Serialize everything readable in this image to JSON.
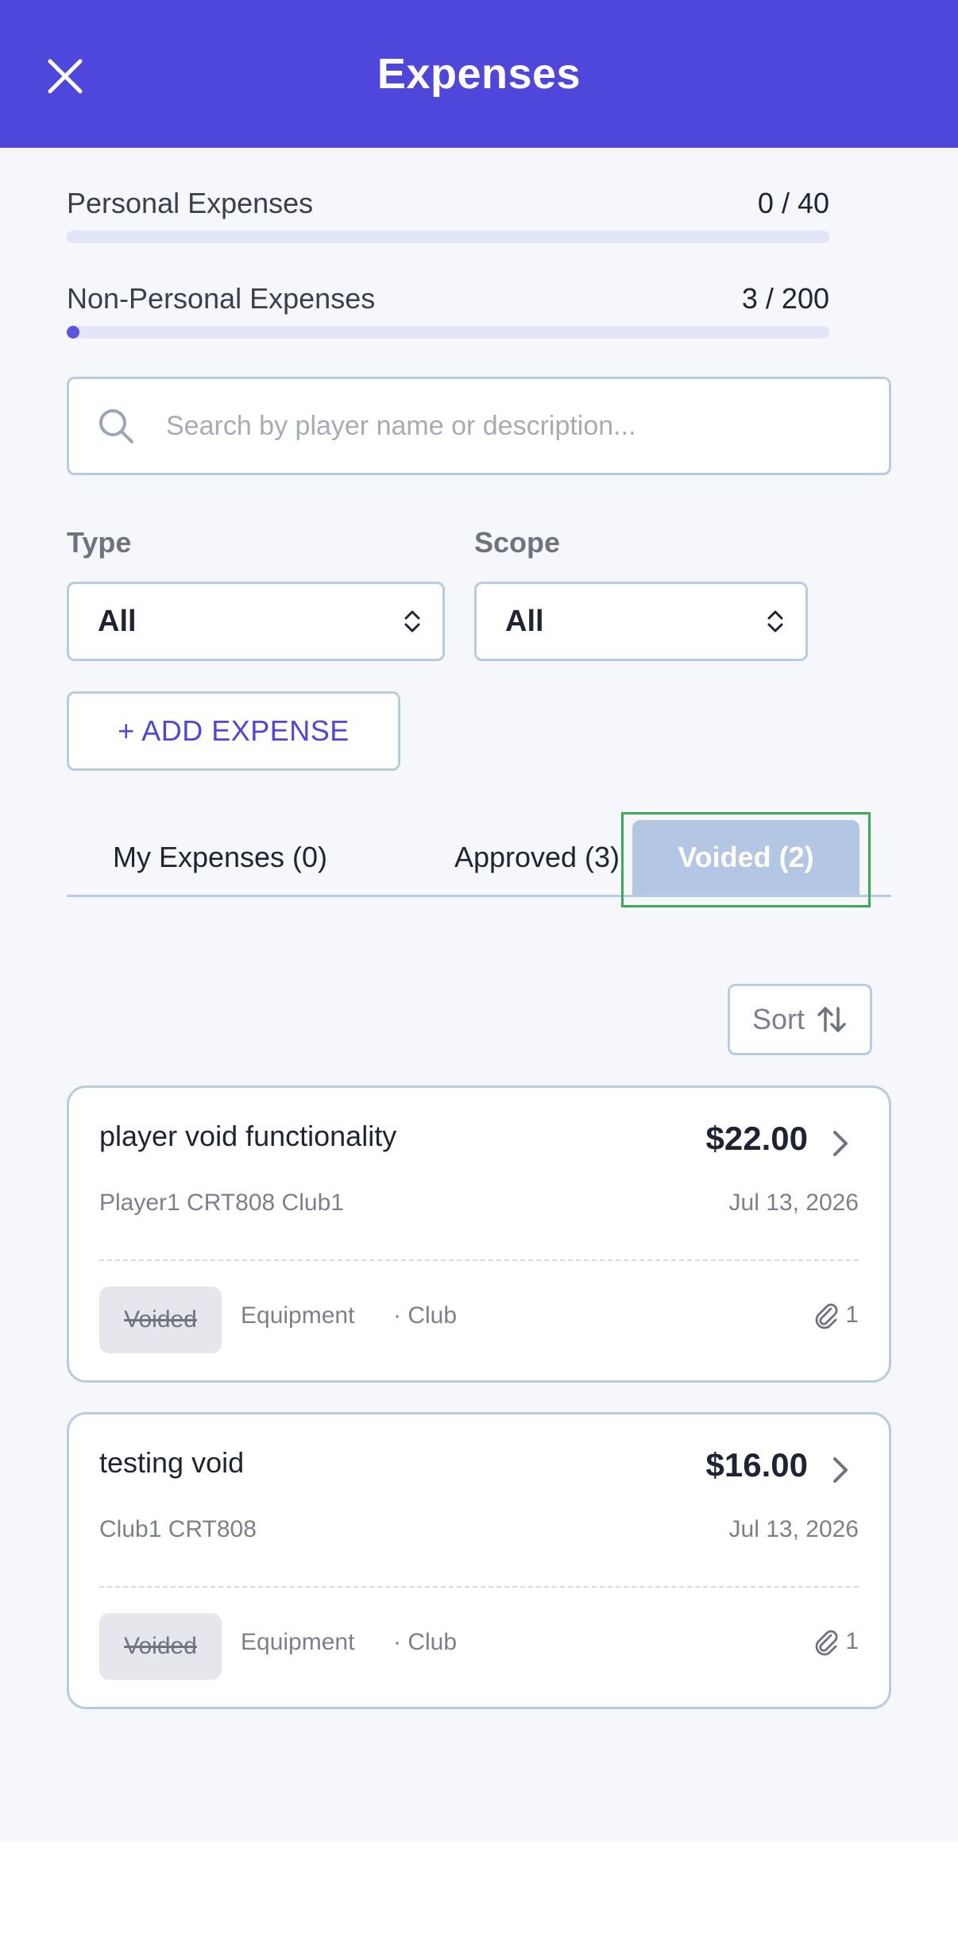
{
  "header": {
    "title": "Expenses"
  },
  "progress": [
    {
      "label": "Personal Expenses",
      "value": "0 / 40",
      "fraction": 0.0
    },
    {
      "label": "Non-Personal Expenses",
      "value": "3 / 200",
      "fraction": 0.015
    }
  ],
  "search": {
    "placeholder": "Search by player name or description..."
  },
  "filters": {
    "type": {
      "label": "Type",
      "value": "All"
    },
    "scope": {
      "label": "Scope",
      "value": "All"
    }
  },
  "add_button": {
    "label": "+ ADD EXPENSE"
  },
  "tabs": [
    {
      "label": "My Expenses (0)"
    },
    {
      "label": "Approved (3)"
    },
    {
      "label": "Voided (2)",
      "active": true
    }
  ],
  "sort": {
    "label": "Sort"
  },
  "expenses": [
    {
      "title": "player void functionality",
      "amount": "$22.00",
      "subtitle": "Player1 CRT808 Club1",
      "date": "Jul 13, 2026",
      "status": "Voided",
      "category": "Equipment",
      "scope": "· Club",
      "attachments": "1"
    },
    {
      "title": "testing void",
      "amount": "$16.00",
      "subtitle": "Club1 CRT808",
      "date": "Jul 13, 2026",
      "status": "Voided",
      "category": "Equipment",
      "scope": "· Club",
      "attachments": "1"
    }
  ],
  "colors": {
    "header_bg": "#4f46dc",
    "active_tab_bg": "#b3c6e4",
    "progress_fill": "#5a55e0",
    "focus_ring": "#3aaa55"
  },
  "icons": [
    "close-icon",
    "search-icon",
    "select-updown-icon",
    "sort-arrows-icon",
    "chevron-right-icon",
    "paperclip-icon"
  ]
}
